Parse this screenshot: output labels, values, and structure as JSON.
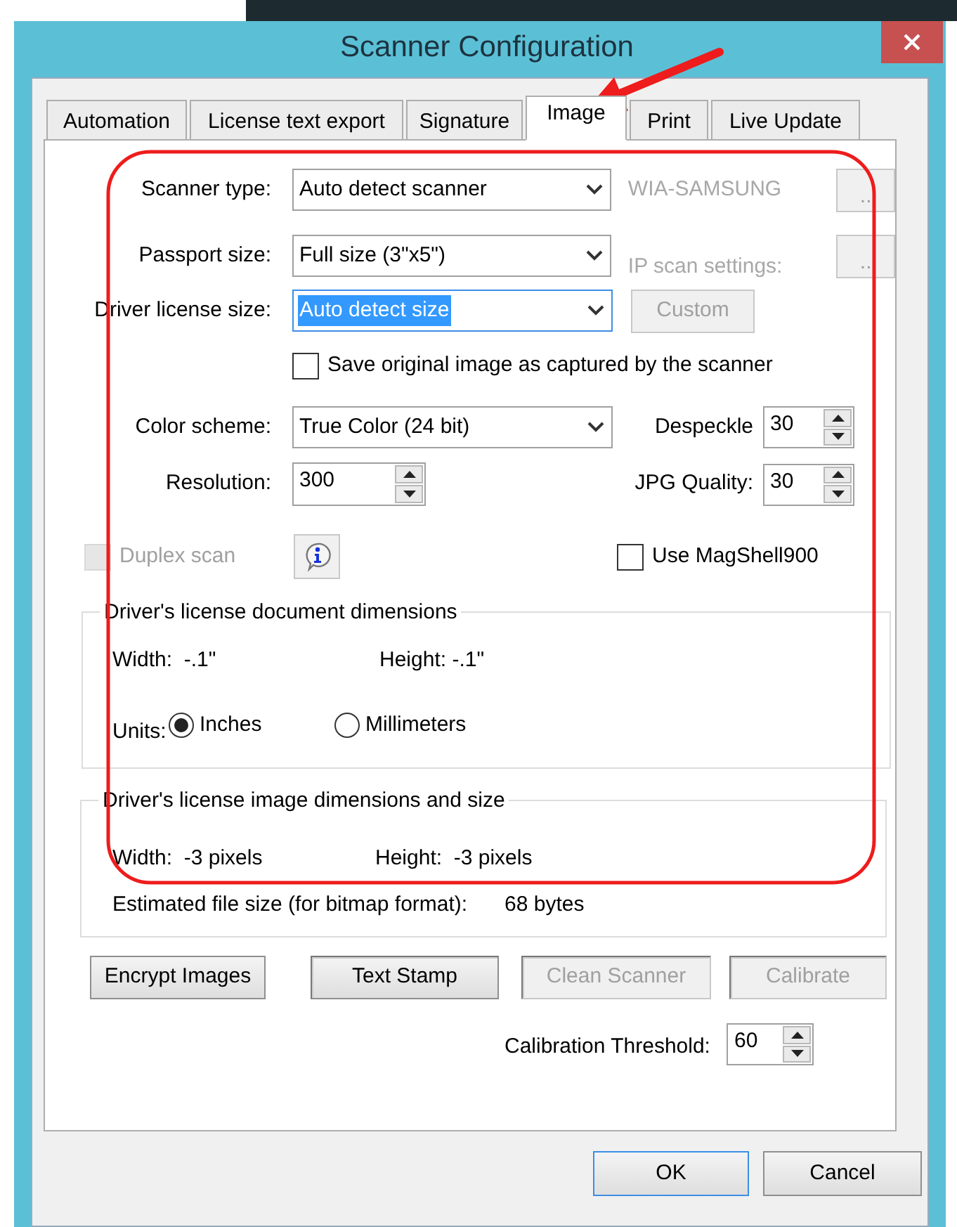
{
  "window": {
    "title": "Scanner Configuration"
  },
  "tabs": [
    {
      "label": "Automation",
      "selected": false
    },
    {
      "label": "License text export",
      "selected": false
    },
    {
      "label": "Signature",
      "selected": false
    },
    {
      "label": "Image",
      "selected": true
    },
    {
      "label": "Print",
      "selected": false
    },
    {
      "label": "Live Update",
      "selected": false
    }
  ],
  "scanner_type": {
    "label": "Scanner type:",
    "value": "Auto detect scanner",
    "side_text": "WIA-SAMSUNG",
    "button": "..",
    "disabled": true
  },
  "passport_size": {
    "label": "Passport size:",
    "value": "Full size (3\"x5\")",
    "side_text": "IP scan settings:",
    "button": "..",
    "disabled": true
  },
  "driver_license_size": {
    "label": "Driver license size:",
    "value": "Auto detect size",
    "focused": true,
    "button": "Custom",
    "button_disabled": true
  },
  "save_original": {
    "label": "Save original image as captured by the scanner",
    "checked": false
  },
  "color_scheme": {
    "label": "Color scheme:",
    "value": "True Color (24 bit)"
  },
  "despeckle": {
    "label": "Despeckle",
    "value": "30"
  },
  "resolution": {
    "label": "Resolution:",
    "value": "300"
  },
  "jpg_quality": {
    "label": "JPG Quality:",
    "value": "30"
  },
  "duplex_scan": {
    "label": "Duplex scan",
    "checked": false,
    "disabled": true
  },
  "use_magshell": {
    "label": "Use MagShell900",
    "checked": false
  },
  "document_dimensions": {
    "title": "Driver's license document dimensions",
    "width_label": "Width:",
    "width": "-.1\"",
    "height_label": "Height:",
    "height": "-.1\"",
    "units_label": "Units:",
    "units": [
      {
        "label": "Inches",
        "selected": true
      },
      {
        "label": "Millimeters",
        "selected": false
      }
    ]
  },
  "image_dimensions": {
    "title": "Driver's license image dimensions and size",
    "width_label": "Width:",
    "width": "-3 pixels",
    "height_label": "Height:",
    "height": "-3 pixels",
    "file_size_label": "Estimated file size (for bitmap format):",
    "file_size": "68 bytes"
  },
  "action_buttons": [
    {
      "label": "Encrypt Images",
      "kind": "push",
      "disabled": false
    },
    {
      "label": "Text Stamp",
      "kind": "toggle",
      "disabled": false
    },
    {
      "label": "Clean Scanner",
      "kind": "toggle",
      "disabled": true
    },
    {
      "label": "Calibrate",
      "kind": "toggle",
      "disabled": true
    }
  ],
  "calibration_threshold": {
    "label": "Calibration Threshold:",
    "value": "60"
  },
  "dialog_buttons": [
    {
      "label": "OK",
      "default": true
    },
    {
      "label": "Cancel",
      "default": false
    }
  ],
  "annotations": {
    "outline": true,
    "arrow": true
  }
}
